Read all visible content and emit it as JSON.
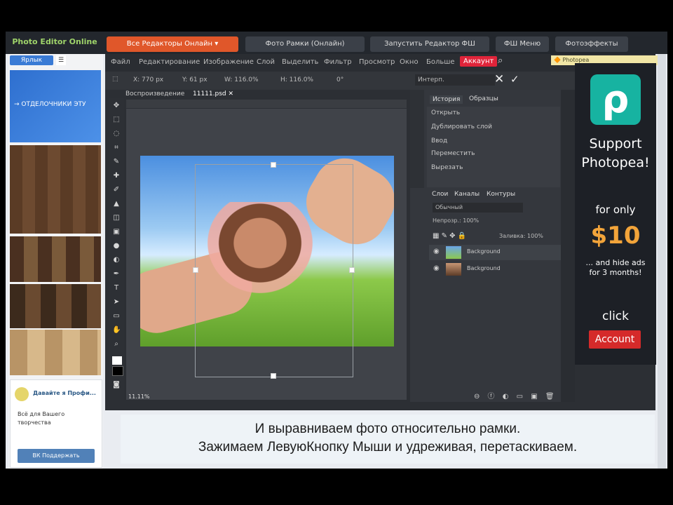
{
  "site": {
    "logo": "Photo Editor Online",
    "top_buttons": [
      "Все Редакторы Онлайн ▾",
      "Фото Рамки (Онлайн)",
      "Запустить Редактор ФШ",
      "ФШ Меню",
      "Фотоэффекты"
    ],
    "left_label": "Ярлык",
    "share": "☰",
    "blue_thumb_text": "→ ОТДЕЛОЧНИКИ ЭТУ"
  },
  "app": {
    "menu": [
      "Файл",
      "Редактирование",
      "Изображение",
      "Слой",
      "Выделить",
      "Фильтр",
      "Просмотр",
      "Окно",
      "Больше",
      "Аккаунт"
    ],
    "active_menu": "Аккаунт",
    "options": [
      "Х: 770 px",
      "Y: 61 px",
      "W: 116.0%",
      "H: 116.0%",
      "0°",
      "Интерп."
    ],
    "tabs": [
      "Воспроизведение",
      "11111.psd ✕"
    ],
    "status": "11.11%",
    "accent": "#e0243a",
    "history_tabs": [
      "История",
      "Образцы"
    ],
    "history": [
      "Открыть",
      "Дублировать слой",
      "Ввод",
      "Переместить",
      "Вырезать"
    ],
    "layer_tabs": [
      "Слои",
      "Каналы",
      "Контуры"
    ],
    "blend": "Обычный",
    "opacity": "Непрозр.: 100%",
    "fill": "Заливка: 100%",
    "layers": [
      "Background",
      "Background"
    ]
  },
  "ad": {
    "line1": "Support",
    "line2": "Photopea!",
    "for_only": "for only",
    "price": "$10",
    "sub1": "... and hide ads",
    "sub2": "for 3 months!",
    "click": "click",
    "account": "Account"
  },
  "vk": {
    "title": "Давайте я Профи...",
    "text1": "Всё для Вашего",
    "text2": "творчества",
    "button": "ВК Поддержать"
  },
  "caption": {
    "line1": "И выравниваем фото относительно рамки.",
    "line2": "Зажимаем ЛевуюКнопку Мыши и удреживая, перетаскиваем."
  }
}
